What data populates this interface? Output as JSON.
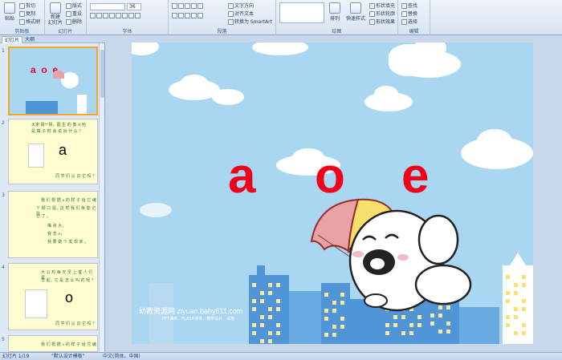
{
  "ribbon": {
    "groups": [
      {
        "label": "剪贴板"
      },
      {
        "label": "幻灯片"
      },
      {
        "label": "字体"
      },
      {
        "label": "段落"
      },
      {
        "label": "绘图"
      },
      {
        "label": "编辑"
      }
    ],
    "clipboard": {
      "paste": "粘贴",
      "cut": "剪切",
      "copy": "复制",
      "format": "格式刷"
    },
    "slides": {
      "new": "新建\n幻灯片",
      "layout": "版式",
      "reset": "重设",
      "delete": "删除"
    },
    "font": {
      "size": "36"
    },
    "paragraph": {
      "textdir": "文字方向",
      "align": "对齐文本",
      "smartart": "转换为 SmartArt"
    },
    "drawing": {
      "arrange": "排列",
      "quickstyles": "快速样式",
      "fill": "形状填充",
      "outline": "形状轮廓",
      "effects": "形状效果"
    },
    "editing": {
      "find": "查找",
      "replace": "替换",
      "select": "选择"
    }
  },
  "pane": {
    "tab_slides": "幻灯片",
    "tab_outline": "大纲",
    "slides": [
      {
        "num": "1",
        "letters": "a  o  e"
      },
      {
        "num": "2",
        "lines": [
          "大家 猜一猜，图 生 的 像 A 哈",
          "是 嘴 子 时 会 说 出 什 么 ？"
        ],
        "letter": "a",
        "footer": "同 学 们 认 识 它 吗 ？"
      },
      {
        "num": "3",
        "lines": [
          "我 们 根 据 a 的 样 子 给 它 编",
          "个 顺 口 溜，这 样 我 们 就 能 记 住",
          "它 了 。",
          "嘴 张 大，",
          "我 念 a，",
          "我 要 做 个 发 现 家 。"
        ]
      },
      {
        "num": "4",
        "lines": [
          "大 公 鸡 每 天 早 上 催 人 们 早",
          "早 起，它 是 怎 么 叫 的 呢 ？"
        ],
        "letter": "o",
        "footer": "同 学 们 认 识 它 吗 ？"
      },
      {
        "num": "5",
        "lines": [
          "我 们 根 据 o 的 样 子 给 它 编"
        ]
      }
    ]
  },
  "slide": {
    "letters": [
      "a",
      "o",
      "e"
    ],
    "watermark": "幼教资源网 ziyuan.baby611.com",
    "watermark_sub": "PPT课件、FLASH课件、教学设计、试卷"
  },
  "status": {
    "slide_pos": "幻灯片 1/19",
    "theme": "\"默认设计模板\"",
    "lang": "中文(简体，中国)"
  }
}
